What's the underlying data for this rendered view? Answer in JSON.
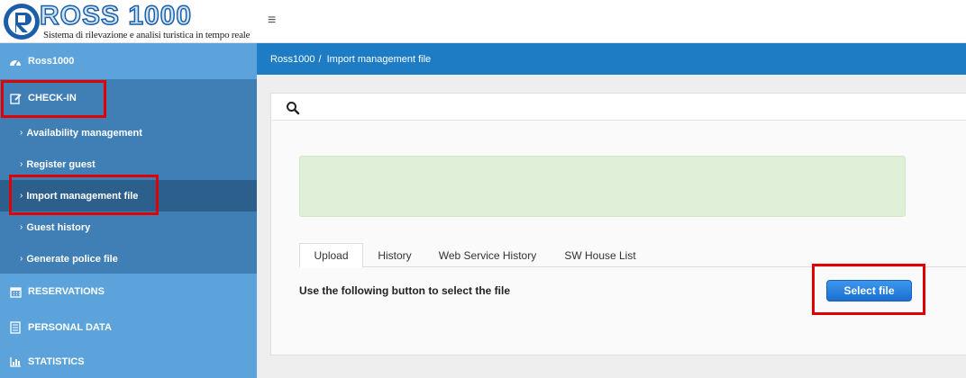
{
  "logo": {
    "title": "ROSS 1000",
    "subtitle": "Sistema di rilevazione e analisi turistica in tempo reale"
  },
  "header": {
    "menu_icon": "≡"
  },
  "sidebar": {
    "home": {
      "label": "Ross1000",
      "icon": "dashboard-icon"
    },
    "checkin": {
      "label": "CHECK-IN",
      "icon": "edit-icon",
      "items": [
        {
          "label": "Availability management"
        },
        {
          "label": "Register guest"
        },
        {
          "label": "Import management file",
          "active": true
        },
        {
          "label": "Guest history"
        },
        {
          "label": "Generate police file"
        }
      ]
    },
    "reservations": {
      "label": "RESERVATIONS",
      "icon": "calendar-icon"
    },
    "personal_data": {
      "label": "PERSONAL DATA",
      "icon": "document-icon"
    },
    "statistics": {
      "label": "STATISTICS",
      "icon": "bar-chart-icon"
    }
  },
  "breadcrumb": {
    "parent": "Ross1000",
    "separator": "/",
    "current": "Import management file"
  },
  "tabs": [
    {
      "label": "Upload",
      "active": true
    },
    {
      "label": "History"
    },
    {
      "label": "Web Service History"
    },
    {
      "label": "SW House List"
    }
  ],
  "upload": {
    "instruction": "Use the following button to select the file",
    "button_label": "Select file"
  },
  "colors": {
    "sidebar": "#5ba3da",
    "sidebar_section": "#3f7fb6",
    "sidebar_active": "#2d5f8c",
    "breadcrumb_bar": "#1e7cc4",
    "alert_success": "#dfefd8",
    "button_primary": "#1a6fd0",
    "highlight_box": "#e00000"
  }
}
